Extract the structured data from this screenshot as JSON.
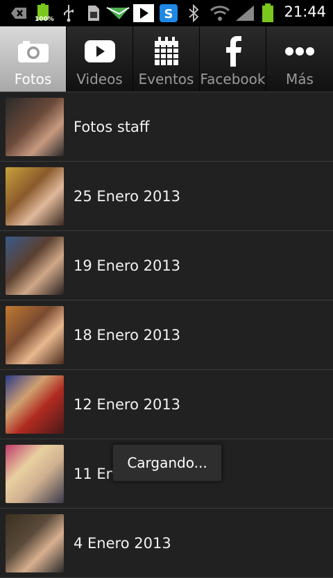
{
  "status_bar": {
    "time": "21:44",
    "battery_percent_label": "100%",
    "icons": [
      "back-icon",
      "battery-icon",
      "usb-icon",
      "sim-icon",
      "mail-icon",
      "play-store-icon",
      "skype-icon",
      "bluetooth-icon",
      "wifi-icon",
      "signal-icon",
      "battery-full-icon"
    ]
  },
  "tabs": [
    {
      "label": "Fotos",
      "icon": "camera-icon",
      "active": true
    },
    {
      "label": "Videos",
      "icon": "play-icon",
      "active": false
    },
    {
      "label": "Eventos",
      "icon": "calendar-icon",
      "active": false
    },
    {
      "label": "Facebook",
      "icon": "facebook-icon",
      "active": false
    },
    {
      "label": "Más",
      "icon": "more-icon",
      "active": false
    }
  ],
  "albums": [
    {
      "label": "Fotos staff",
      "thumb_color": "#6b4a3a"
    },
    {
      "label": "25 Enero 2013",
      "thumb_color": "#8a5a2c"
    },
    {
      "label": "19 Enero 2013",
      "thumb_color": "#5a4030"
    },
    {
      "label": "18 Enero 2013",
      "thumb_color": "#7a4a30"
    },
    {
      "label": "12 Enero 2013",
      "thumb_color": "#7a2a20"
    },
    {
      "label": "11 Enero 2013",
      "thumb_color": "#6a3a4a"
    },
    {
      "label": "4 Enero 2013",
      "thumb_color": "#5a4a3a"
    }
  ],
  "toast": {
    "text": "Cargando..."
  }
}
